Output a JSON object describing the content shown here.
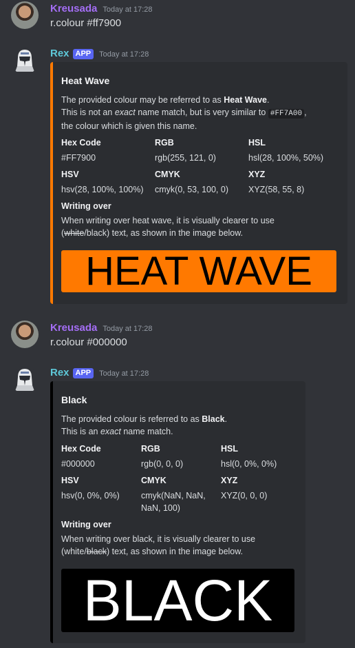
{
  "messages": [
    {
      "author": "Kreusada",
      "timestamp": "Today at 17:28",
      "text": "r.colour #ff7900"
    },
    {
      "author": "Rex",
      "badge": "APP",
      "timestamp": "Today at 17:28",
      "embed": {
        "accent": "#ff7900",
        "title": "Heat Wave",
        "line1_pre": "The provided colour may be referred to as ",
        "line1_bold": "Heat Wave",
        "line1_post": ".",
        "line2_pre": "This is not an ",
        "line2_em": "exact",
        "line2_mid": " name match, but is very similar to ",
        "line2_code": "#FF7A00",
        "line2_post": ",",
        "line3": "the colour which is given this name.",
        "fields": [
          {
            "name": "Hex Code",
            "value": "#FF7900"
          },
          {
            "name": "RGB",
            "value": "rgb(255, 121, 0)"
          },
          {
            "name": "HSL",
            "value": "hsl(28, 100%, 50%)"
          },
          {
            "name": "HSV",
            "value": "hsv(28, 100%, 100%)"
          },
          {
            "name": "CMYK",
            "value": "cmyk(0, 53, 100, 0)"
          },
          {
            "name": "XYZ",
            "value": "XYZ(58, 55, 8)"
          }
        ],
        "writing_title": "Writing over",
        "writing_line1": "When writing over heat wave, it is visually clearer to use",
        "writing_open": "(",
        "writing_a": "white",
        "writing_sep": "/",
        "writing_b": "black",
        "writing_close": ") text, as shown in the image below.",
        "swatch_text": "HEAT WAVE",
        "swatch_bg": "#ff7900",
        "swatch_fg": "#000000"
      }
    },
    {
      "author": "Kreusada",
      "timestamp": "Today at 17:28",
      "text": "r.colour #000000"
    },
    {
      "author": "Rex",
      "badge": "APP",
      "timestamp": "Today at 17:28",
      "embed": {
        "accent": "#000000",
        "title": "Black",
        "line1_pre": "The provided colour is referred to as ",
        "line1_bold": "Black",
        "line1_post": ".",
        "line2_pre": "This is an ",
        "line2_em": "exact",
        "line2_post": " name match.",
        "fields": [
          {
            "name": "Hex Code",
            "value": "#000000"
          },
          {
            "name": "RGB",
            "value": "rgb(0, 0, 0)"
          },
          {
            "name": "HSL",
            "value": "hsl(0, 0%, 0%)"
          },
          {
            "name": "HSV",
            "value": "hsv(0, 0%, 0%)"
          },
          {
            "name": "CMYK",
            "value": "cmyk(NaN, NaN,",
            "value2": "NaN, 100)"
          },
          {
            "name": "XYZ",
            "value": "XYZ(0, 0, 0)"
          }
        ],
        "writing_title": "Writing over",
        "writing_line1": "When writing over black, it is visually clearer to use",
        "writing_open": "(",
        "writing_a": "white",
        "writing_sep": "/",
        "writing_b": "black",
        "writing_close": ") text, as shown in the image below.",
        "swatch_text": "BLACK",
        "swatch_bg": "#000000",
        "swatch_fg": "#ffffff"
      }
    }
  ]
}
